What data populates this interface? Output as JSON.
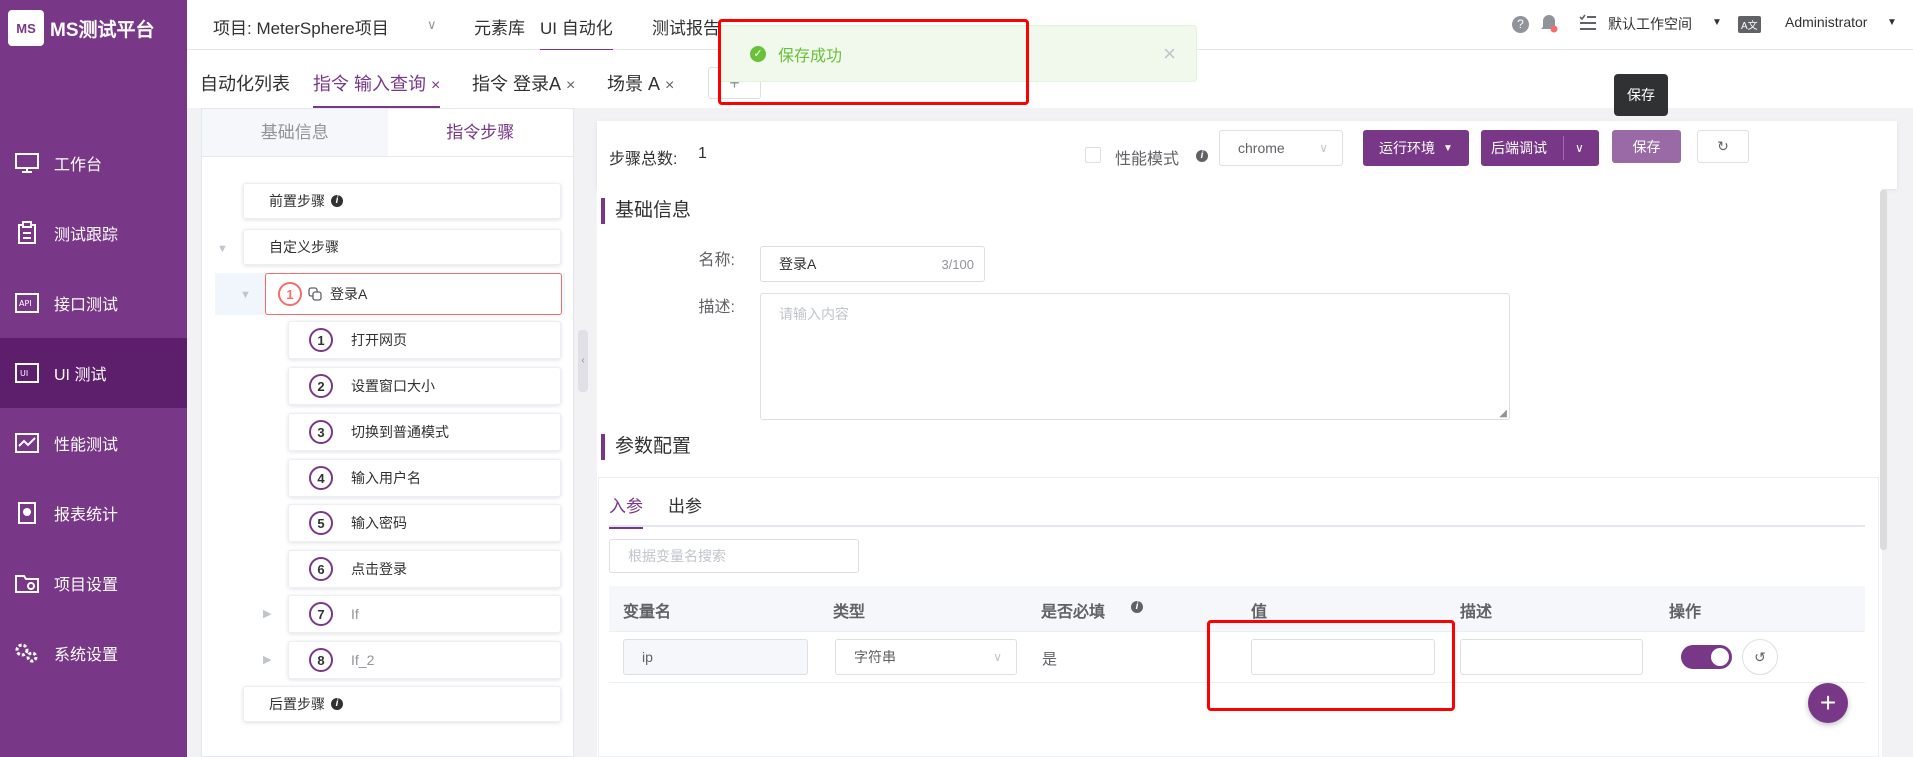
{
  "app": {
    "logo_mark": "MS",
    "name": "MS测试平台"
  },
  "sidebar": {
    "items": [
      {
        "label": "工作台",
        "icon": "monitor-icon"
      },
      {
        "label": "测试跟踪",
        "icon": "clipboard-icon"
      },
      {
        "label": "接口测试",
        "icon": "api-icon"
      },
      {
        "label": "UI 测试",
        "icon": "ui-test-icon"
      },
      {
        "label": "性能测试",
        "icon": "performance-icon"
      },
      {
        "label": "报表统计",
        "icon": "report-icon"
      },
      {
        "label": "项目设置",
        "icon": "folder-settings-icon"
      },
      {
        "label": "系统设置",
        "icon": "gears-icon"
      }
    ]
  },
  "topbar": {
    "project": "项目: MeterSphere项目",
    "nav": [
      "元素库",
      "UI 自动化",
      "测试报告"
    ],
    "workspace": "默认工作空间",
    "user": "Administrator",
    "lang_badge": "A文"
  },
  "subtabs": {
    "list": "自动化列表",
    "tabs": [
      "指令 输入查询",
      "指令 登录A",
      "场景 A"
    ],
    "close": "×",
    "add": "+"
  },
  "left_panel": {
    "tabs": [
      "基础信息",
      "指令步骤"
    ],
    "pre_steps": "前置步骤",
    "custom_steps": "自定义步骤",
    "post_steps": "后置步骤",
    "info_mark": "i",
    "selected_step": {
      "num": "1",
      "label": "登录A"
    },
    "steps": [
      {
        "num": "1",
        "label": "打开网页"
      },
      {
        "num": "2",
        "label": "设置窗口大小"
      },
      {
        "num": "3",
        "label": "切换到普通模式"
      },
      {
        "num": "4",
        "label": "输入用户名"
      },
      {
        "num": "5",
        "label": "输入密码"
      },
      {
        "num": "6",
        "label": "点击登录"
      },
      {
        "num": "7",
        "label": "If"
      },
      {
        "num": "8",
        "label": "If_2"
      }
    ]
  },
  "toolbar": {
    "step_count_label": "步骤总数:",
    "step_count": "1",
    "perf_mode": "性能模式",
    "browser": "chrome",
    "env_btn": "运行环境",
    "debug_btn": "后端调试",
    "save_btn": "保存"
  },
  "toast": {
    "message": "保存成功",
    "close": "×"
  },
  "tooltip": {
    "text": "保存"
  },
  "basic_info": {
    "title": "基础信息",
    "name_label": "名称:",
    "name_value": "登录A",
    "name_count": "3/100",
    "desc_label": "描述:",
    "desc_placeholder": "请输入内容"
  },
  "params": {
    "title": "参数配置",
    "tabs": [
      "入参",
      "出参"
    ],
    "search_placeholder": "根据变量名搜索",
    "headers": [
      "变量名",
      "类型",
      "是否必填",
      "值",
      "描述",
      "操作"
    ],
    "row": {
      "name": "ip",
      "type": "字符串",
      "required": "是",
      "value": "",
      "desc": "",
      "enabled": true
    }
  },
  "colors": {
    "brand": "#783887",
    "success": "#67c23a",
    "highlight": "#ff0000"
  }
}
